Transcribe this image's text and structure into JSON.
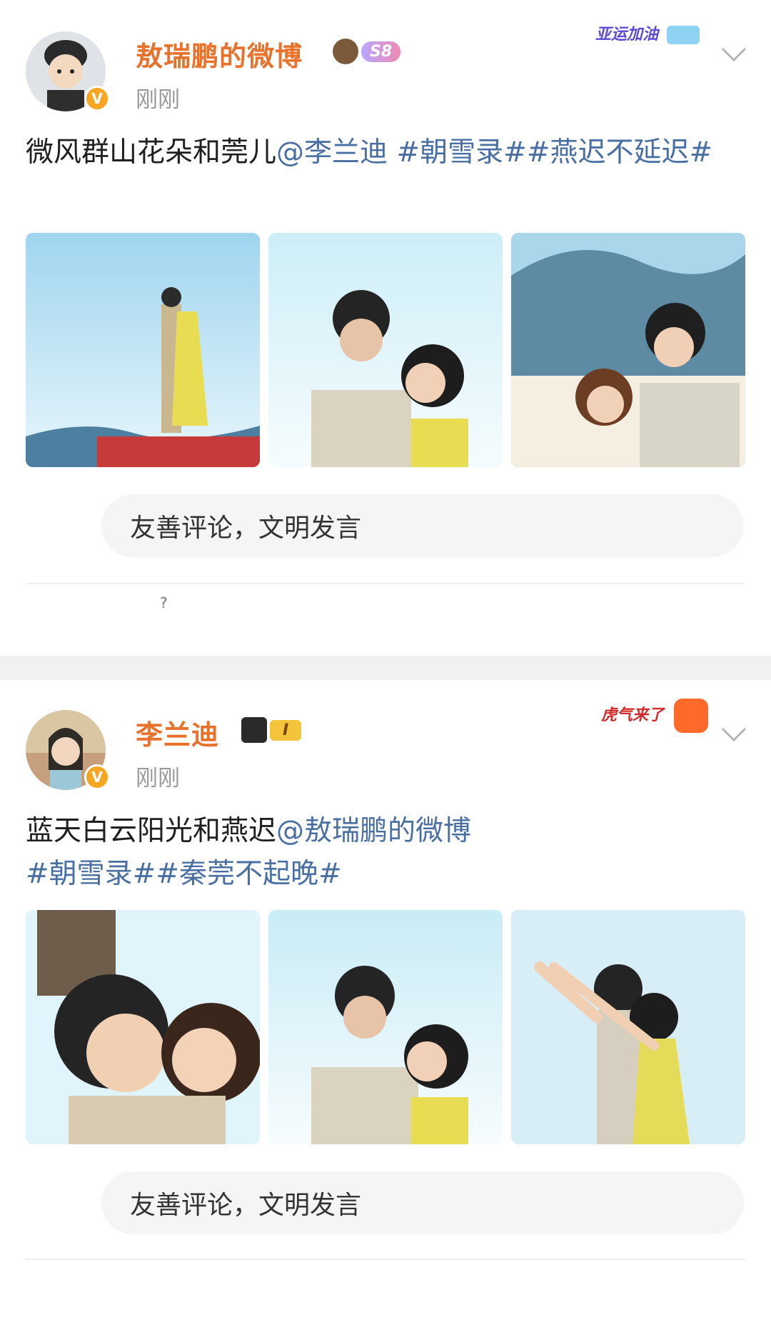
{
  "posts": [
    {
      "username": "敖瑞鹏的微博",
      "level_badge": "S8",
      "campaign_badge": "亚运加油",
      "timestamp": "刚刚",
      "text": {
        "plain": "微风群山花朵和莞儿",
        "mention": "@李兰迪",
        "hashtag1": " #朝雪录#",
        "hashtag2": "#燕迟不延迟#"
      },
      "comment_placeholder": "友善评论，文明发言",
      "footer_residue": "?"
    },
    {
      "username": "李兰迪",
      "level_badge": "I",
      "campaign_badge": "虎气来了",
      "timestamp": "刚刚",
      "text": {
        "plain": "蓝天白云阳光和燕迟",
        "mention": "@敖瑞鹏的微博",
        "hashtag1": "#朝雪录#",
        "hashtag2": "#秦莞不起晚#"
      },
      "comment_placeholder": "友善评论，文明发言"
    }
  ],
  "colors": {
    "username": "#e8712b",
    "link": "#4a6fa3",
    "timestamp": "#9a9a9a",
    "verified": "#f6a623",
    "separator": "#f1f1f1"
  },
  "icons": {
    "verified": "verified-v-icon",
    "more": "chevron-down-icon"
  }
}
